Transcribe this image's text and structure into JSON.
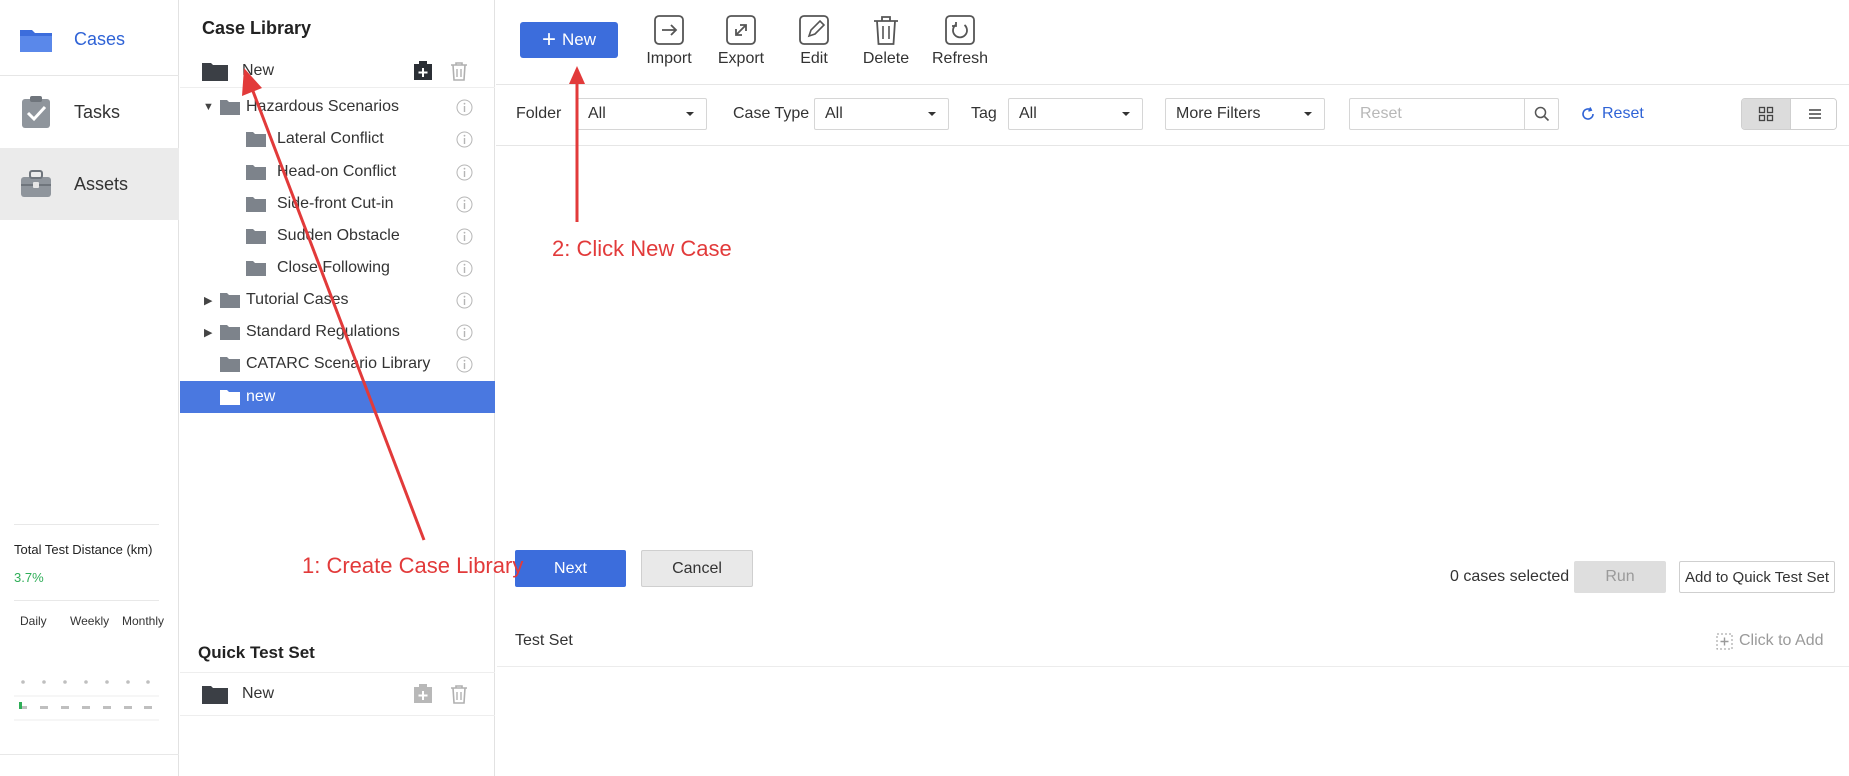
{
  "nav": {
    "items": [
      {
        "label": "Cases",
        "icon": "folder-icon"
      },
      {
        "label": "Tasks",
        "icon": "clipboard-check-icon"
      },
      {
        "label": "Assets",
        "icon": "toolbox-icon"
      }
    ]
  },
  "stats": {
    "title": "Total Test Distance (km)",
    "percent": "3.7%",
    "periods": [
      "Daily",
      "Weekly",
      "Monthly"
    ]
  },
  "library": {
    "title": "Case Library",
    "root_label": "New",
    "tree": [
      {
        "label": "Hazardous Scenarios",
        "expanded": true
      },
      {
        "label": "Lateral Conflict"
      },
      {
        "label": "Head-on Conflict"
      },
      {
        "label": "Side-front Cut-in"
      },
      {
        "label": "Sudden Obstacle"
      },
      {
        "label": "Close Following"
      },
      {
        "label": "Tutorial Cases",
        "expanded": false
      },
      {
        "label": "Standard Regulations",
        "expanded": false
      },
      {
        "label": "CATARC Scenario Library"
      },
      {
        "label": "new",
        "selected": true
      }
    ]
  },
  "quick_test": {
    "title": "Quick Test Set",
    "root_label": "New"
  },
  "toolbar": {
    "new_label": "New",
    "tools": [
      {
        "label": "Import",
        "icon": "import-icon"
      },
      {
        "label": "Export",
        "icon": "export-icon"
      },
      {
        "label": "Edit",
        "icon": "edit-icon"
      },
      {
        "label": "Delete",
        "icon": "trash-icon"
      },
      {
        "label": "Refresh",
        "icon": "refresh-icon"
      }
    ]
  },
  "filters": {
    "folder_label": "Folder",
    "folder_value": "All",
    "case_type_label": "Case Type",
    "case_type_value": "All",
    "tag_label": "Tag",
    "tag_value": "All",
    "more_filters": "More Filters",
    "search_placeholder": "Reset",
    "reset_label": "Reset"
  },
  "actions": {
    "next": "Next",
    "cancel": "Cancel",
    "selected_count": "0 cases selected",
    "run": "Run",
    "add_quick": "Add to Quick Test Set"
  },
  "test_set": {
    "title": "Test Set",
    "click_add": "Click to Add"
  },
  "annotations": {
    "step1": "1: Create Case Library",
    "step2": "2: Click New Case"
  },
  "colors": {
    "accent": "#3c6ddc",
    "selected_row": "#4a78e0",
    "annotation": "#e23a3a",
    "positive": "#2fae58"
  }
}
